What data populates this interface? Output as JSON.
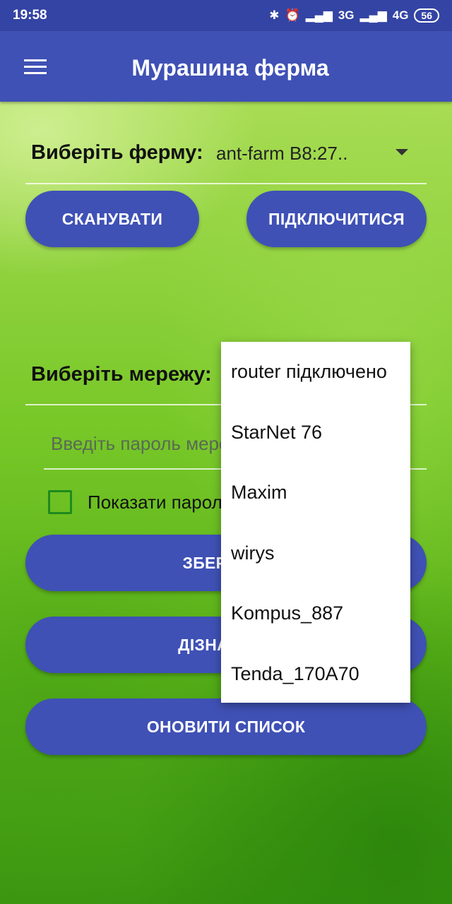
{
  "status_bar": {
    "time": "19:58",
    "network_1": "3G",
    "network_2": "4G",
    "battery": "56",
    "icons": [
      "bluetooth-icon",
      "alarm-icon",
      "signal-icon"
    ]
  },
  "app_bar": {
    "title": "Мурашина ферма",
    "menu_icon": "hamburger-menu-icon"
  },
  "farm": {
    "label": "Виберіть ферму:",
    "selected": "ant-farm B8:27.."
  },
  "buttons": {
    "scan": "СКАНУВАТИ",
    "connect": "ПІДКЛЮЧИТИСЯ",
    "save": "ЗБЕРЕГТИ",
    "find_out": "ДІЗНАТИСЯ",
    "refresh": "ОНОВИТИ СПИСОК"
  },
  "network": {
    "label": "Виберіть мережу:",
    "password_placeholder": "Введіть пароль мережі",
    "show_password_label": "Показати пароль"
  },
  "dropdown": {
    "options": [
      "router підключено",
      "StarNet 76",
      "Maxim",
      "wirys",
      "Kompus_887",
      "Tenda_170A70"
    ]
  },
  "colors": {
    "primary": "#3f51b5",
    "status_bar": "#3444a4",
    "checkbox": "#1e8a1e"
  }
}
